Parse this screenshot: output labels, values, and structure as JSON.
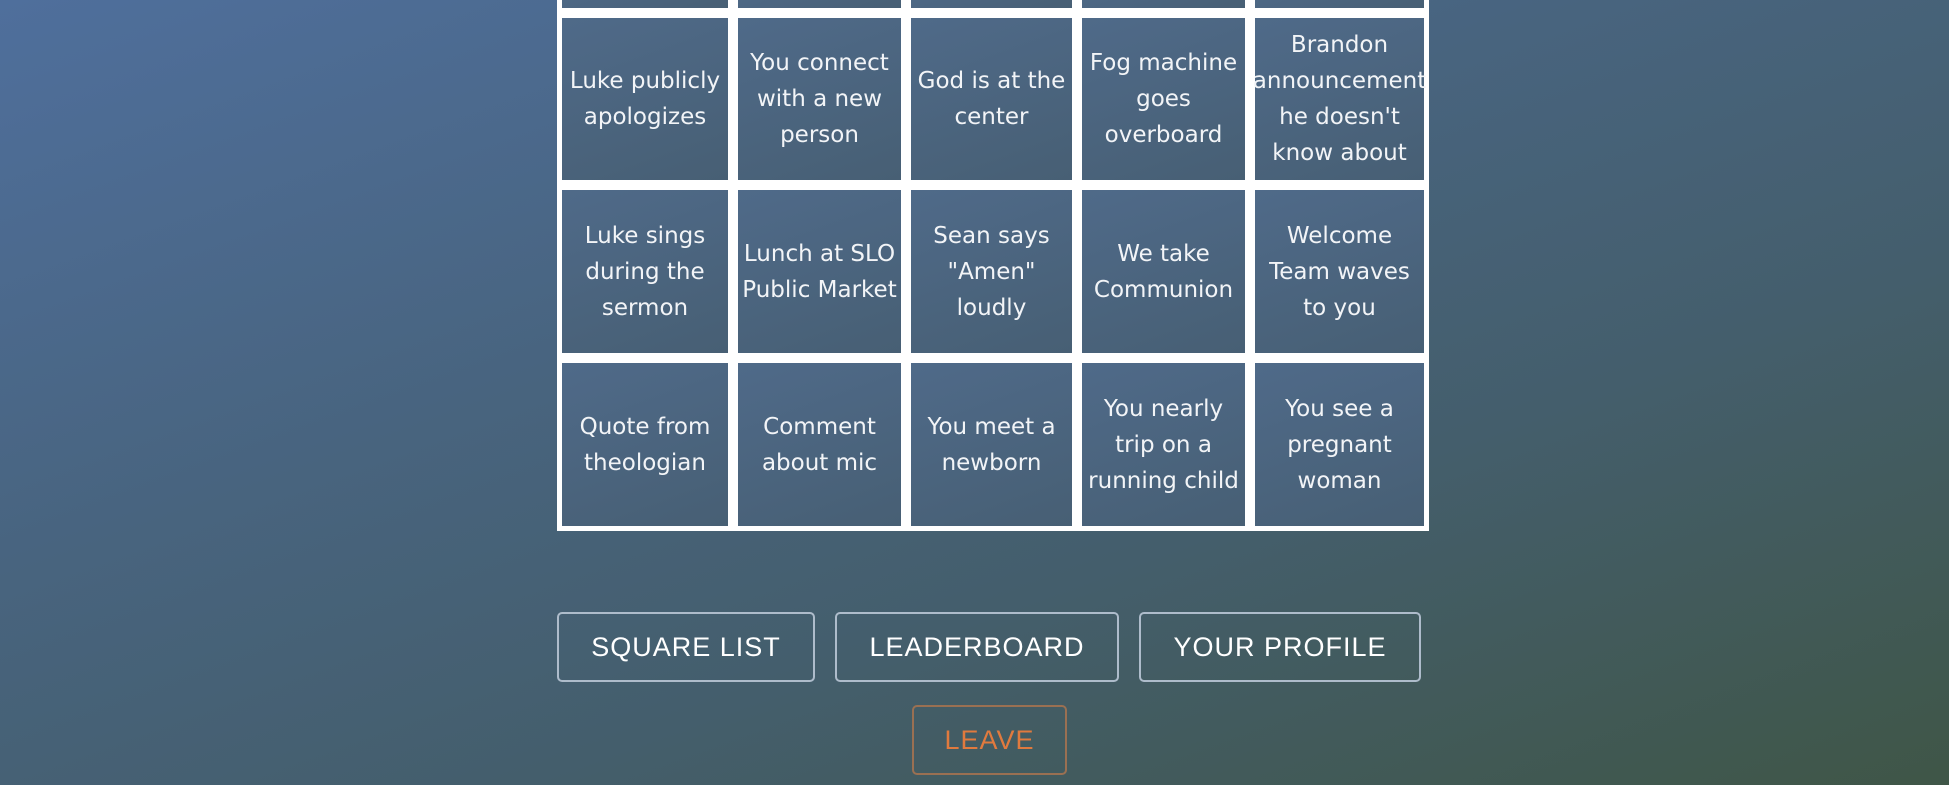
{
  "board": {
    "rows": [
      [
        "",
        "",
        "",
        "",
        ""
      ],
      [
        "Luke publicly apologizes",
        "You connect with a new person",
        "God is at the center",
        "Fog machine goes overboard",
        "Brandon announcement he doesn't know about"
      ],
      [
        "Luke sings during the sermon",
        "Lunch at SLO Public Market",
        "Sean says \"Amen\" loudly",
        "We take Communion",
        "Welcome Team waves to you"
      ],
      [
        "Quote from theologian",
        "Comment about mic",
        "You meet a newborn",
        "You nearly trip on a running child",
        "You see a pregnant woman"
      ]
    ]
  },
  "nav": {
    "square_list": "SQUARE LIST",
    "leaderboard": "LEADERBOARD",
    "your_profile": "YOUR PROFILE",
    "leave": "LEAVE"
  },
  "colors": {
    "accent_leave": "#e07a3e",
    "cell_border": "#ffffff"
  }
}
